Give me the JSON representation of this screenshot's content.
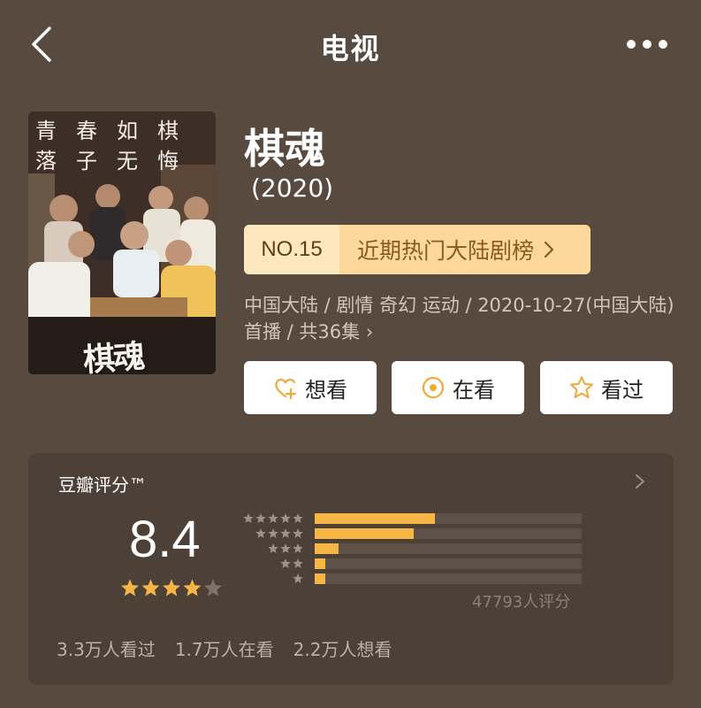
{
  "header": {
    "title": "电视",
    "back_icon": "chevron-left-icon",
    "more_icon": "more-horizontal-icon"
  },
  "poster": {
    "tagline_line1": "青春如棋",
    "tagline_line2": "落子无悔",
    "logo_text": "棋魂"
  },
  "show": {
    "title": "棋魂",
    "year": "(2020)",
    "rank_no": "NO.15",
    "rank_label": "近期热门大陆剧榜",
    "meta": "中国大陆 / 剧情 奇幻 运动 / 2020-10-27(中国大陆) 首播 / 共36集",
    "meta_chevron": "›"
  },
  "actions": {
    "want": "想看",
    "doing": "在看",
    "done": "看过"
  },
  "rating": {
    "title": "豆瓣评分™",
    "score": "8.4",
    "score_stars": 4,
    "distribution_percent": [
      45,
      37,
      9,
      4,
      4
    ],
    "count_text": "47793人评分",
    "stats": [
      "3.3万人看过",
      "1.7万人在看",
      "2.2万人想看"
    ]
  },
  "colors": {
    "background": "#584a3f",
    "card": "#4c4037",
    "accent": "#f7b545",
    "rank_bg": "#fdd89c",
    "rank_text": "#8a5a1e"
  }
}
